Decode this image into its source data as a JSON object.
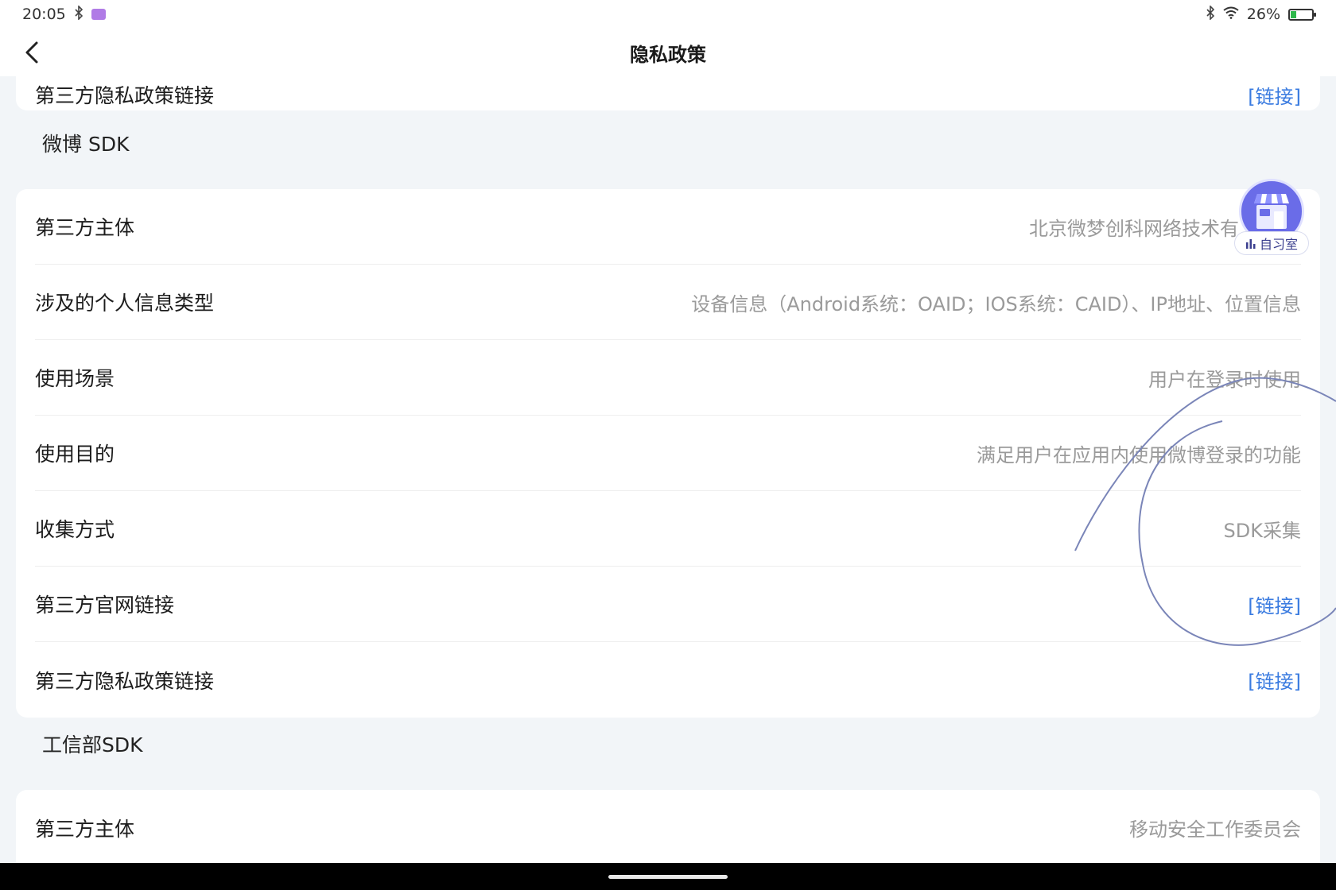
{
  "status": {
    "time": "20:05",
    "battery": "26%",
    "battery_level": 0.26
  },
  "nav": {
    "title": "隐私政策"
  },
  "prev_card": {
    "label": "第三方隐私政策链接",
    "link": "[链接]"
  },
  "sections": [
    {
      "title": "微博 SDK",
      "rows": [
        {
          "label": "第三方主体",
          "value": "北京微梦创科网络技术有"
        },
        {
          "label": "涉及的个人信息类型",
          "value": "设备信息（Android系统：OAID；IOS系统：CAID）、IP地址、位置信息"
        },
        {
          "label": "使用场景",
          "value": "用户在登录时使用"
        },
        {
          "label": "使用目的",
          "value": "满足用户在应用内使用微博登录的功能"
        },
        {
          "label": "收集方式",
          "value": "SDK采集"
        },
        {
          "label": "第三方官网链接",
          "link": "[链接]"
        },
        {
          "label": "第三方隐私政策链接",
          "link": "[链接]"
        }
      ]
    },
    {
      "title": "工信部SDK",
      "rows": [
        {
          "label": "第三方主体",
          "value": "移动安全工作委员会"
        }
      ]
    }
  ],
  "widget": {
    "label": "自习室",
    "icon_text": "自习"
  },
  "colors": {
    "link": "#3a7be0",
    "accent": "#6a6ce8",
    "background": "#f2f5f8"
  }
}
